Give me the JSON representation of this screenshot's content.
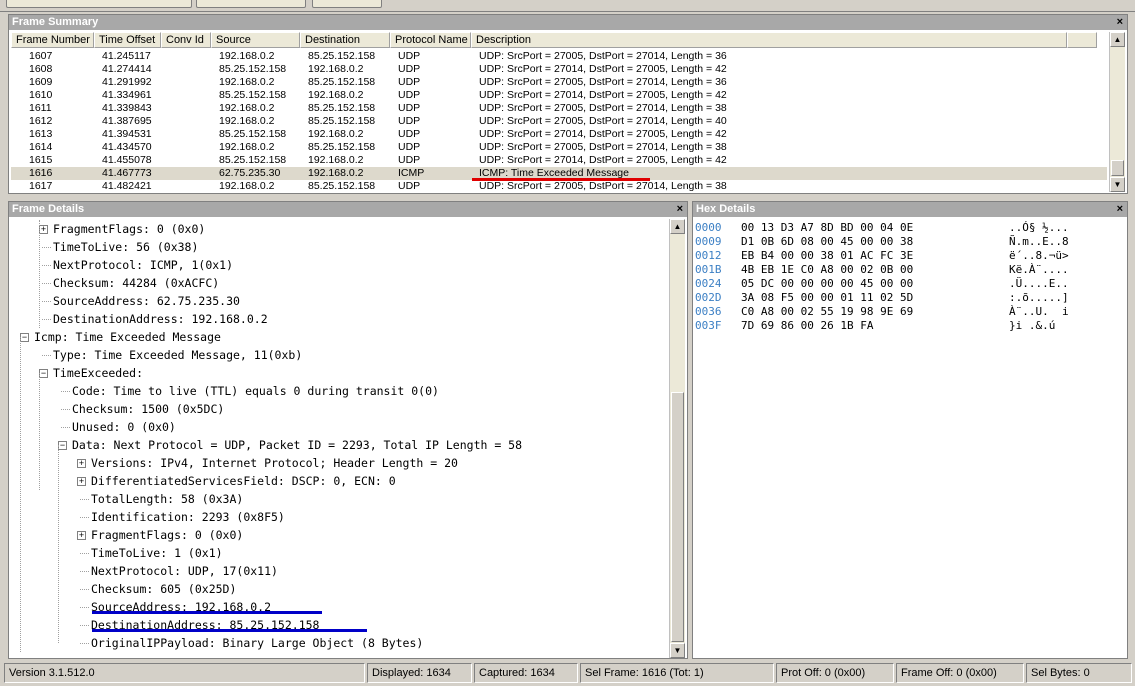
{
  "summary": {
    "title": "Frame Summary",
    "columns": [
      "Frame Number",
      "Time Offset",
      "Conv Id",
      "Source",
      "Destination",
      "Protocol Name",
      "Description"
    ],
    "rows": [
      [
        "1607",
        "41.245117",
        "",
        "192.168.0.2",
        "85.25.152.158",
        "UDP",
        "UDP: SrcPort = 27005, DstPort = 27014, Length = 36"
      ],
      [
        "1608",
        "41.274414",
        "",
        "85.25.152.158",
        "192.168.0.2",
        "UDP",
        "UDP: SrcPort = 27014, DstPort = 27005, Length = 42"
      ],
      [
        "1609",
        "41.291992",
        "",
        "192.168.0.2",
        "85.25.152.158",
        "UDP",
        "UDP: SrcPort = 27005, DstPort = 27014, Length = 36"
      ],
      [
        "1610",
        "41.334961",
        "",
        "85.25.152.158",
        "192.168.0.2",
        "UDP",
        "UDP: SrcPort = 27014, DstPort = 27005, Length = 42"
      ],
      [
        "1611",
        "41.339843",
        "",
        "192.168.0.2",
        "85.25.152.158",
        "UDP",
        "UDP: SrcPort = 27005, DstPort = 27014, Length = 38"
      ],
      [
        "1612",
        "41.387695",
        "",
        "192.168.0.2",
        "85.25.152.158",
        "UDP",
        "UDP: SrcPort = 27005, DstPort = 27014, Length = 40"
      ],
      [
        "1613",
        "41.394531",
        "",
        "85.25.152.158",
        "192.168.0.2",
        "UDP",
        "UDP: SrcPort = 27014, DstPort = 27005, Length = 42"
      ],
      [
        "1614",
        "41.434570",
        "",
        "192.168.0.2",
        "85.25.152.158",
        "UDP",
        "UDP: SrcPort = 27005, DstPort = 27014, Length = 38"
      ],
      [
        "1615",
        "41.455078",
        "",
        "85.25.152.158",
        "192.168.0.2",
        "UDP",
        "UDP: SrcPort = 27014, DstPort = 27005, Length = 42"
      ],
      [
        "1616",
        "41.467773",
        "",
        "62.75.235.30",
        "192.168.0.2",
        "ICMP",
        "ICMP: Time Exceeded Message"
      ],
      [
        "1617",
        "41.482421",
        "",
        "192.168.0.2",
        "85.25.152.158",
        "UDP",
        "UDP: SrcPort = 27005, DstPort = 27014, Length = 38"
      ]
    ],
    "selected_row": 9
  },
  "details": {
    "title": "Frame Details",
    "lines": [
      "FragmentFlags: 0 (0x0)",
      "TimeToLive: 56 (0x38)",
      "NextProtocol: ICMP, 1(0x1)",
      "Checksum: 44284 (0xACFC)",
      "SourceAddress: 62.75.235.30",
      "DestinationAddress: 192.168.0.2",
      "Icmp: Time Exceeded Message",
      "Type: Time Exceeded Message, 11(0xb)",
      "TimeExceeded:",
      "Code: Time to live (TTL) equals 0 during transit 0(0)",
      "Checksum: 1500 (0x5DC)",
      "Unused: 0 (0x0)",
      "Data: Next Protocol = UDP, Packet ID = 2293, Total IP Length = 58",
      "Versions: IPv4, Internet Protocol; Header Length = 20",
      "DifferentiatedServicesField: DSCP: 0, ECN: 0",
      "TotalLength: 58 (0x3A)",
      "Identification: 2293 (0x8F5)",
      "FragmentFlags: 0 (0x0)",
      "TimeToLive: 1 (0x1)",
      "NextProtocol: UDP, 17(0x11)",
      "Checksum: 605 (0x25D)",
      "SourceAddress: 192.168.0.2",
      "DestinationAddress: 85.25.152.158",
      "OriginalIPPayload: Binary Large Object (8 Bytes)"
    ]
  },
  "hex": {
    "title": "Hex Details",
    "rows": [
      {
        "offset": "0000",
        "bytes": "00 13 D3 A7 8D BD 00 04 0E",
        "ascii": "..Ó§ ½..."
      },
      {
        "offset": "0009",
        "bytes": "D1 0B 6D 08 00 45 00 00 38",
        "ascii": "Ñ.m..E..8"
      },
      {
        "offset": "0012",
        "bytes": "EB B4 00 00 38 01 AC FC 3E",
        "ascii": "ë´..8.¬ü>"
      },
      {
        "offset": "001B",
        "bytes": "4B EB 1E C0 A8 00 02 0B 00",
        "ascii": "Kë.À¨...."
      },
      {
        "offset": "0024",
        "bytes": "05 DC 00 00 00 00 45 00 00",
        "ascii": ".Ü....E.."
      },
      {
        "offset": "002D",
        "bytes": "3A 08 F5 00 00 01 11 02 5D",
        "ascii": ":.õ.....]"
      },
      {
        "offset": "0036",
        "bytes": "C0 A8 00 02 55 19 98 9E 69",
        "ascii": "À¨..U.  i"
      },
      {
        "offset": "003F",
        "bytes": "7D 69 86 00 26 1B FA",
        "ascii": "}i .&.ú"
      }
    ]
  },
  "status": {
    "version": "Version 3.1.512.0",
    "displayed": "Displayed: 1634",
    "captured": "Captured: 1634",
    "sel_frame": "Sel Frame: 1616 (Tot: 1)",
    "prot_off": "Prot Off: 0 (0x00)",
    "frame_off": "Frame Off: 0 (0x00)",
    "sel_bytes": "Sel Bytes: 0"
  },
  "icons": {
    "close": "close-icon",
    "expand": "expand-icon",
    "collapse": "collapse-icon",
    "scroll_up": "scroll-up-icon",
    "scroll_down": "scroll-down-icon"
  },
  "colors": {
    "highlight_red": "#e00000",
    "highlight_blue": "#0000c8",
    "hex_offset": "#3b7fc4",
    "selected_row": "#ddd9cc"
  }
}
